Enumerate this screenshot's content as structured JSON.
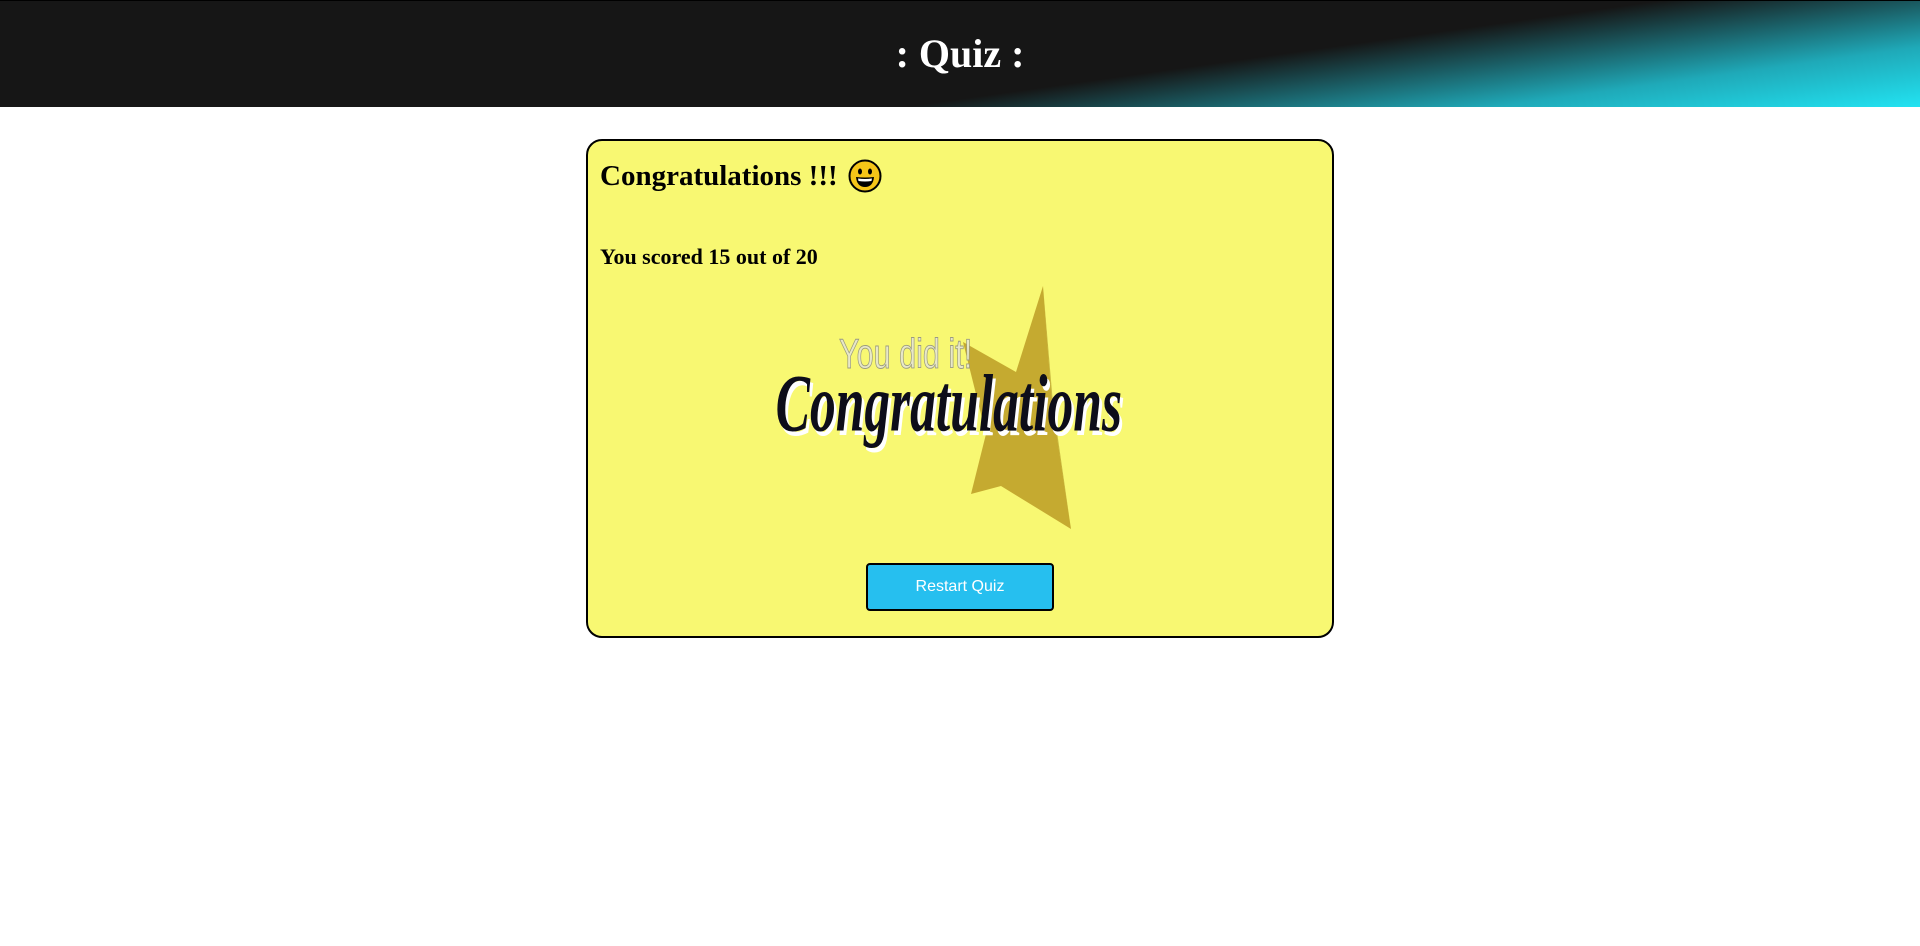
{
  "header": {
    "title": ": Quiz :",
    "colors": {
      "dark": "#161616",
      "accent": "#22e3f2"
    }
  },
  "result": {
    "heading": "Congratulations !!!",
    "emoji_icon": "grinning-face-icon",
    "score_text": "You scored 15 out of 20",
    "score": 15,
    "total": 20,
    "card_color": "#f8f872"
  },
  "banner": {
    "small_text": "You did it!",
    "main_text": "Congratulations",
    "star_color": "#c2a52c"
  },
  "actions": {
    "restart_label": "Restart Quiz",
    "button_color": "#26bfef"
  }
}
